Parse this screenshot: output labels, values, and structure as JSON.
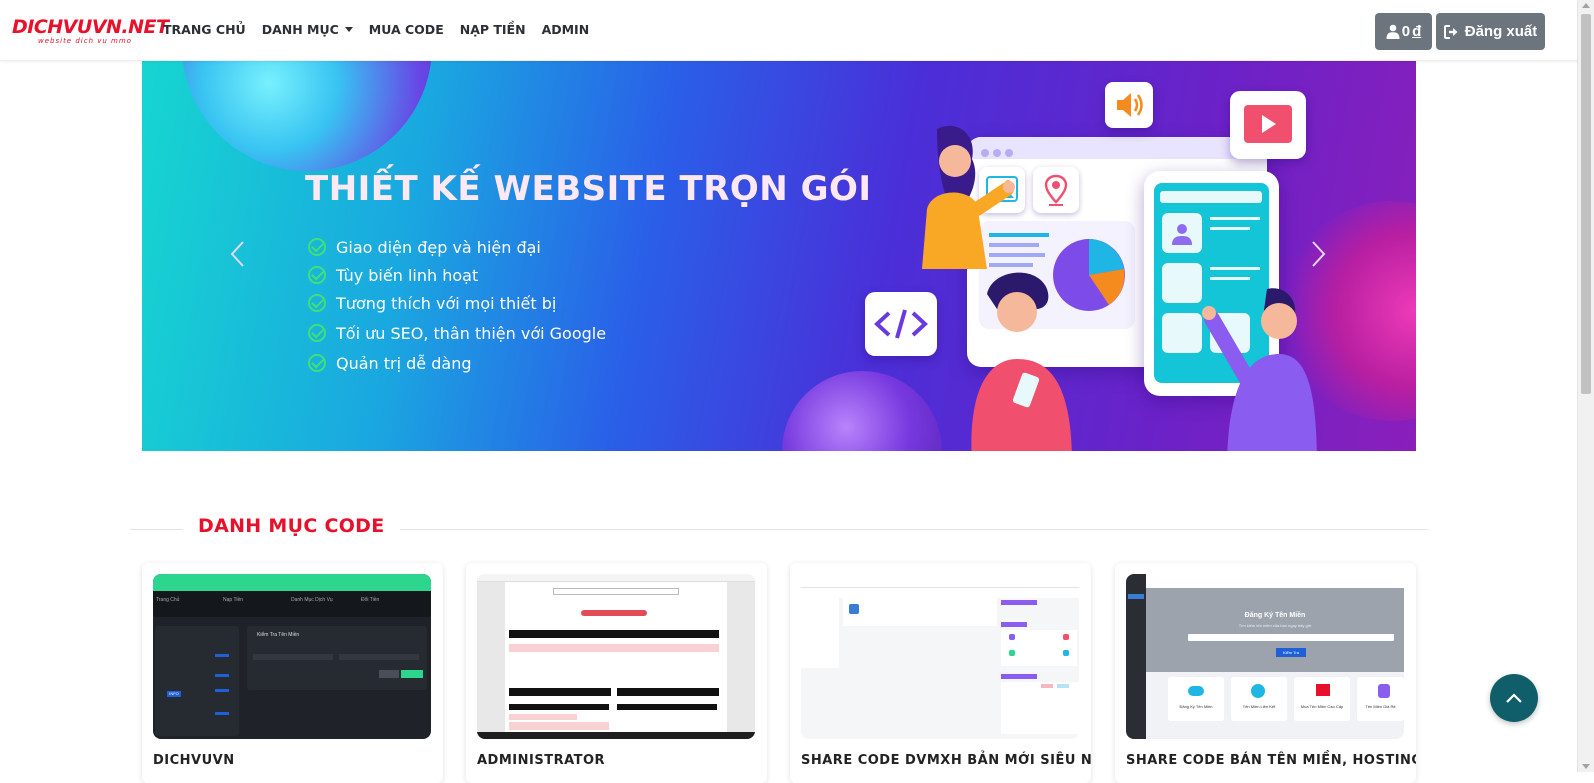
{
  "navbar": {
    "logo": {
      "main": "DICHVUVN.NET",
      "sub": "website dich vu mmo"
    },
    "links": [
      {
        "label": "TRANG CHỦ"
      },
      {
        "label": "DANH MỤC",
        "dropdown": true
      },
      {
        "label": "MUA CODE"
      },
      {
        "label": "NẠP TIỀN"
      },
      {
        "label": "ADMIN"
      }
    ],
    "balance": {
      "amount": "0",
      "currency": "đ"
    },
    "logout_label": "Đăng xuất"
  },
  "banner": {
    "title": "THIẾT KẾ WEBSITE TRỌN GÓI",
    "features": [
      "Giao diện đẹp và hiện đại",
      "Tùy biến linh hoạt",
      "Tương thích với mọi thiết bị",
      "Tối ưu SEO, thân thiện với Google",
      "Quản trị dễ dàng"
    ]
  },
  "section": {
    "title": "DANH MỤC CODE"
  },
  "cards": [
    {
      "title": "DICHVUVN",
      "thumb": {
        "menu": [
          "Trang Chủ",
          "Nạp Tiền",
          "Danh Mục Dịch Vụ",
          "Đổi Tiền"
        ],
        "panel_title": "Kiểm Tra Tên Miền",
        "brand": "INFO"
      }
    },
    {
      "title": "ADMINISTRATOR",
      "thumb": {}
    },
    {
      "title": "SHARE CODE DVMXH BẢN MỚI SIÊU NGON",
      "thumb": {}
    },
    {
      "title": "SHARE CODE BÁN TÊN MIỀN, HOSTING AUTO",
      "thumb": {
        "heading": "Đăng Ký Tên Miền",
        "subheading": "Tìm kiếm tên miền của bạn ngay bây giờ",
        "search_button": "Kiểm Tra",
        "tiles": [
          "Đăng Ký Tên Miền",
          "Tên Miền Liên Kết",
          "Mua Tên Miền Cao Cấp",
          "Tên Miền Giá Rẻ"
        ]
      }
    }
  ],
  "colors": {
    "brand_red": "#e8102b",
    "button_gray": "#6c757d",
    "back_to_top": "#0f5e6a",
    "check_green": "#3fe07a"
  },
  "icons": {
    "balance": "user-icon",
    "logout": "sign-out-icon",
    "prev": "chevron-left-icon",
    "next": "chevron-right-icon",
    "back_to_top": "chevron-up-icon"
  }
}
